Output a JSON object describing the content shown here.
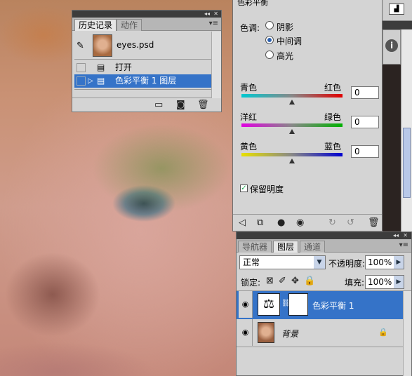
{
  "history": {
    "tabs": [
      "历史记录",
      "动作"
    ],
    "snapshot": "eyes.psd",
    "items": [
      "打开",
      "色彩平衡 1 图层"
    ]
  },
  "color_balance": {
    "title": "色彩平衡",
    "tone_label": "色调:",
    "tones": [
      "阴影",
      "中间调",
      "高光"
    ],
    "selected_tone": "中间调",
    "sliders": [
      {
        "left": "青色",
        "right": "红色",
        "value": "0",
        "left_color": "#00c8d0",
        "right_color": "#e00000"
      },
      {
        "left": "洋红",
        "right": "绿色",
        "value": "0",
        "left_color": "#e000e0",
        "right_color": "#00b000"
      },
      {
        "left": "黄色",
        "right": "蓝色",
        "value": "0",
        "left_color": "#e8e000",
        "right_color": "#0000d0"
      }
    ],
    "preserve_label": "保留明度",
    "preserve_checked": true
  },
  "layers": {
    "tabs": [
      "导航器",
      "图层",
      "通道"
    ],
    "blend_mode": "正常",
    "opacity_label": "不透明度:",
    "opacity": "100%",
    "lock_label": "锁定:",
    "fill_label": "填充:",
    "fill": "100%",
    "items": [
      {
        "name": "色彩平衡 1",
        "selected": true
      },
      {
        "name": "背景",
        "selected": false
      }
    ]
  },
  "icons": [
    "history-brush-icon",
    "snapshot-icon",
    "adjustment-icon",
    "mask-icon",
    "eye-icon",
    "lock-icon",
    "trash-icon",
    "info-icon"
  ]
}
